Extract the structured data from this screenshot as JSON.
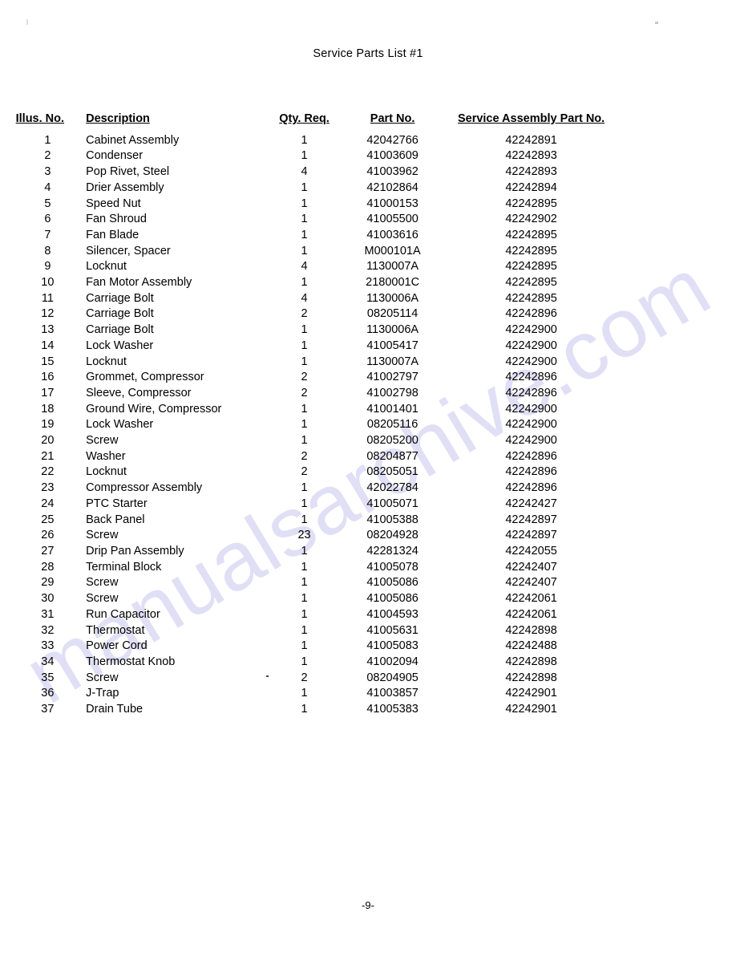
{
  "document": {
    "title": "Service Parts List #1",
    "page_number": "-9-",
    "watermark": "manualsarchive.com"
  },
  "table": {
    "headers": {
      "illus_no": "Illus. No.",
      "description": "Description",
      "qty_req": "Qty. Req.",
      "part_no": "Part No.",
      "service_assembly_part_no": "Service Assembly Part No."
    },
    "rows": [
      {
        "illus_no": "1",
        "description": "Cabinet Assembly",
        "qty_req": "1",
        "part_no": "42042766",
        "service_assembly_part_no": "42242891"
      },
      {
        "illus_no": "2",
        "description": "Condenser",
        "qty_req": "1",
        "part_no": "41003609",
        "service_assembly_part_no": "42242893"
      },
      {
        "illus_no": "3",
        "description": "Pop Rivet, Steel",
        "qty_req": "4",
        "part_no": "41003962",
        "service_assembly_part_no": "42242893"
      },
      {
        "illus_no": "4",
        "description": "Drier Assembly",
        "qty_req": "1",
        "part_no": "42102864",
        "service_assembly_part_no": "42242894"
      },
      {
        "illus_no": "5",
        "description": "Speed Nut",
        "qty_req": "1",
        "part_no": "41000153",
        "service_assembly_part_no": "42242895"
      },
      {
        "illus_no": "6",
        "description": "Fan Shroud",
        "qty_req": "1",
        "part_no": "41005500",
        "service_assembly_part_no": "42242902"
      },
      {
        "illus_no": "7",
        "description": "Fan Blade",
        "qty_req": "1",
        "part_no": "41003616",
        "service_assembly_part_no": "42242895"
      },
      {
        "illus_no": "8",
        "description": "Silencer, Spacer",
        "qty_req": "1",
        "part_no": "M000101A",
        "service_assembly_part_no": "42242895"
      },
      {
        "illus_no": "9",
        "description": "Locknut",
        "qty_req": "4",
        "part_no": "1130007A",
        "service_assembly_part_no": "42242895"
      },
      {
        "illus_no": "10",
        "description": "Fan Motor Assembly",
        "qty_req": "1",
        "part_no": "2180001C",
        "service_assembly_part_no": "42242895"
      },
      {
        "illus_no": "11",
        "description": "Carriage Bolt",
        "qty_req": "4",
        "part_no": "1130006A",
        "service_assembly_part_no": "42242895"
      },
      {
        "illus_no": "12",
        "description": "Carriage Bolt",
        "qty_req": "2",
        "part_no": "08205114",
        "service_assembly_part_no": "42242896"
      },
      {
        "illus_no": "13",
        "description": "Carriage Bolt",
        "qty_req": "1",
        "part_no": "1130006A",
        "service_assembly_part_no": "42242900"
      },
      {
        "illus_no": "14",
        "description": "Lock Washer",
        "qty_req": "1",
        "part_no": "41005417",
        "service_assembly_part_no": "42242900"
      },
      {
        "illus_no": "15",
        "description": "Locknut",
        "qty_req": "1",
        "part_no": "1130007A",
        "service_assembly_part_no": "42242900"
      },
      {
        "illus_no": "16",
        "description": "Grommet, Compressor",
        "qty_req": "2",
        "part_no": "41002797",
        "service_assembly_part_no": "42242896"
      },
      {
        "illus_no": "17",
        "description": "Sleeve, Compressor",
        "qty_req": "2",
        "part_no": "41002798",
        "service_assembly_part_no": "42242896"
      },
      {
        "illus_no": "18",
        "description": "Ground Wire, Compressor",
        "qty_req": "1",
        "part_no": "41001401",
        "service_assembly_part_no": "42242900"
      },
      {
        "illus_no": "19",
        "description": "Lock Washer",
        "qty_req": "1",
        "part_no": "08205116",
        "service_assembly_part_no": "42242900"
      },
      {
        "illus_no": "20",
        "description": "Screw",
        "qty_req": "1",
        "part_no": "08205200",
        "service_assembly_part_no": "42242900"
      },
      {
        "illus_no": "21",
        "description": "Washer",
        "qty_req": "2",
        "part_no": "08204877",
        "service_assembly_part_no": "42242896"
      },
      {
        "illus_no": "22",
        "description": "Locknut",
        "qty_req": "2",
        "part_no": "08205051",
        "service_assembly_part_no": "42242896"
      },
      {
        "illus_no": "23",
        "description": "Compressor Assembly",
        "qty_req": "1",
        "part_no": "42022784",
        "service_assembly_part_no": "42242896"
      },
      {
        "illus_no": "24",
        "description": "PTC Starter",
        "qty_req": "1",
        "part_no": "41005071",
        "service_assembly_part_no": "42242427"
      },
      {
        "illus_no": "25",
        "description": "Back Panel",
        "qty_req": "1",
        "part_no": "41005388",
        "service_assembly_part_no": "42242897"
      },
      {
        "illus_no": "26",
        "description": "Screw",
        "qty_req": "23",
        "part_no": "08204928",
        "service_assembly_part_no": "42242897"
      },
      {
        "illus_no": "27",
        "description": "Drip Pan Assembly",
        "qty_req": "1",
        "part_no": "42281324",
        "service_assembly_part_no": "42242055"
      },
      {
        "illus_no": "28",
        "description": "Terminal Block",
        "qty_req": "1",
        "part_no": "41005078",
        "service_assembly_part_no": "42242407"
      },
      {
        "illus_no": "29",
        "description": "Screw",
        "qty_req": "1",
        "part_no": "41005086",
        "service_assembly_part_no": "42242407"
      },
      {
        "illus_no": "30",
        "description": "Screw",
        "qty_req": "1",
        "part_no": "41005086",
        "service_assembly_part_no": "42242061"
      },
      {
        "illus_no": "31",
        "description": "Run Capacitor",
        "qty_req": "1",
        "part_no": "41004593",
        "service_assembly_part_no": "42242061"
      },
      {
        "illus_no": "32",
        "description": "Thermostat",
        "qty_req": "1",
        "part_no": "41005631",
        "service_assembly_part_no": "42242898"
      },
      {
        "illus_no": "33",
        "description": "Power Cord",
        "qty_req": "1",
        "part_no": "41005083",
        "service_assembly_part_no": "42242488"
      },
      {
        "illus_no": "34",
        "description": "Thermostat Knob",
        "qty_req": "1",
        "part_no": "41002094",
        "service_assembly_part_no": "42242898"
      },
      {
        "illus_no": "35",
        "description": "Screw",
        "qty_req": "2",
        "part_no": "08204905",
        "service_assembly_part_no": "42242898"
      },
      {
        "illus_no": "36",
        "description": "J-Trap",
        "qty_req": "1",
        "part_no": "41003857",
        "service_assembly_part_no": "42242901"
      },
      {
        "illus_no": "37",
        "description": "Drain Tube",
        "qty_req": "1",
        "part_no": "41005383",
        "service_assembly_part_no": "42242901"
      }
    ]
  }
}
